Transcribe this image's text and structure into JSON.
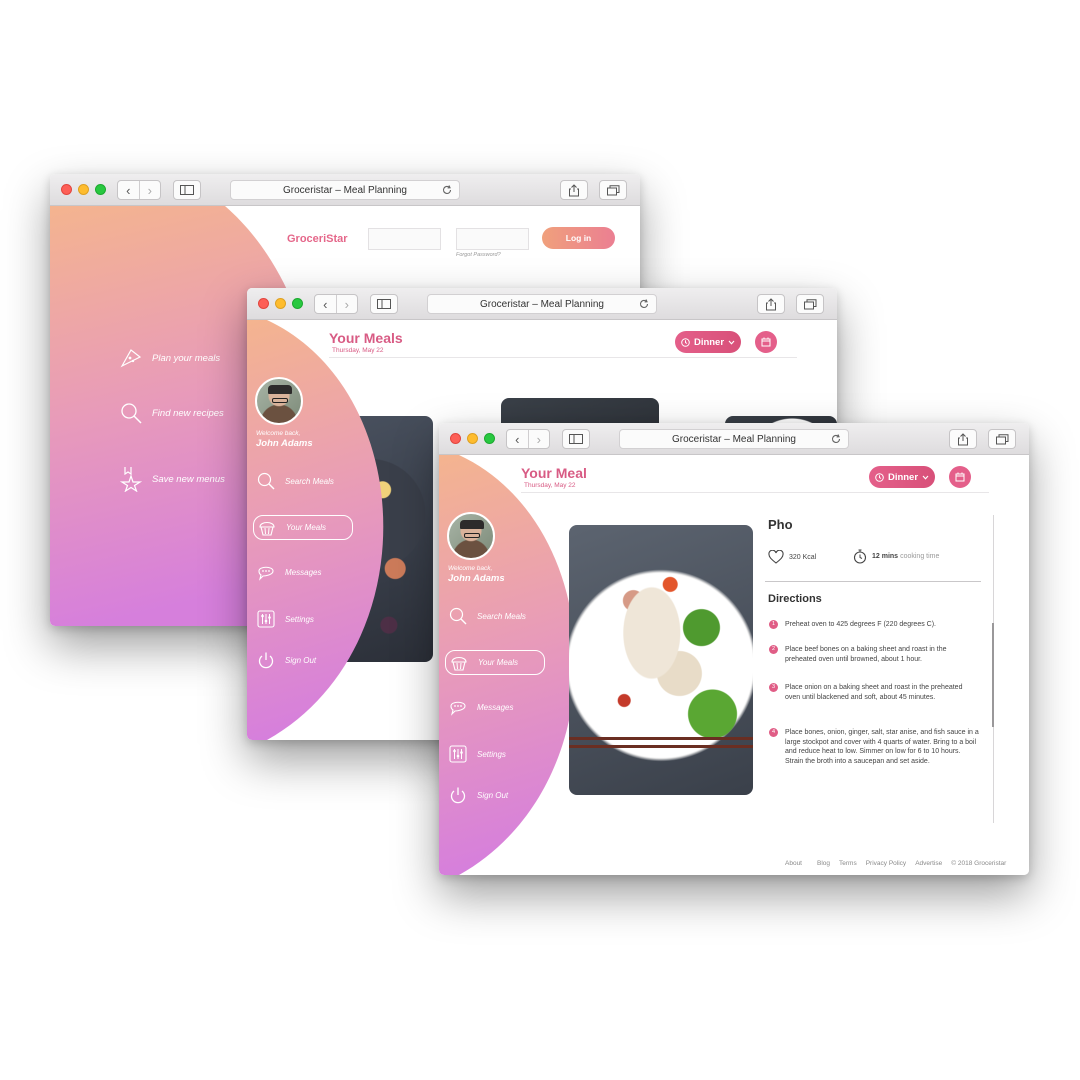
{
  "browser": {
    "url_title": "Groceristar – Meal Planning",
    "back_glyph": "‹",
    "forward_glyph": "›"
  },
  "login_page": {
    "brand": "GroceriStar",
    "login_label": "Log in",
    "forgot_password": "Forgot Password?",
    "features": [
      "Plan your meals",
      "Find new recipes",
      "Save new menus"
    ]
  },
  "user": {
    "welcome": "Welcome back,",
    "name": "John Adams"
  },
  "sidebar": {
    "items": [
      {
        "label": "Search Meals",
        "icon": "search-icon"
      },
      {
        "label": "Your Meals",
        "icon": "cupcake-icon",
        "active": true
      },
      {
        "label": "Messages",
        "icon": "chat-icon"
      },
      {
        "label": "Settings",
        "icon": "sliders-icon"
      },
      {
        "label": "Sign Out",
        "icon": "power-icon"
      }
    ]
  },
  "meals_page": {
    "title": "Your Meals",
    "date": "Thursday, May 22",
    "meal_select": "Dinner"
  },
  "meal_page": {
    "title": "Your Meal",
    "date": "Thursday, May 22",
    "meal_select": "Dinner",
    "recipe": {
      "name": "Pho",
      "calories": "320 Kcal",
      "time_value": "12 mins",
      "time_label": "cooking time",
      "directions_heading": "Directions",
      "steps": [
        "Preheat oven to 425 degrees F (220 degrees C).",
        "Place beef bones on a baking sheet and roast in the preheated oven until browned, about 1 hour.",
        "Place onion on a baking sheet and roast in the preheated oven until blackened and soft, about 45 minutes.",
        "Place bones, onion, ginger, salt, star anise, and fish sauce in a large stockpot and cover with 4 quarts of water. Bring to a boil and reduce heat to low. Simmer on low for 6 to 10 hours. Strain the broth into a saucepan and set aside."
      ]
    },
    "footer": {
      "links": [
        "About",
        "Blog",
        "Terms",
        "Privacy Policy",
        "Advertise"
      ],
      "copyright": "© 2018 Groceristar"
    }
  },
  "colors": {
    "accent": "#e05d86",
    "gradient_top": "#f4b48f",
    "gradient_bottom": "#d77fdc"
  }
}
